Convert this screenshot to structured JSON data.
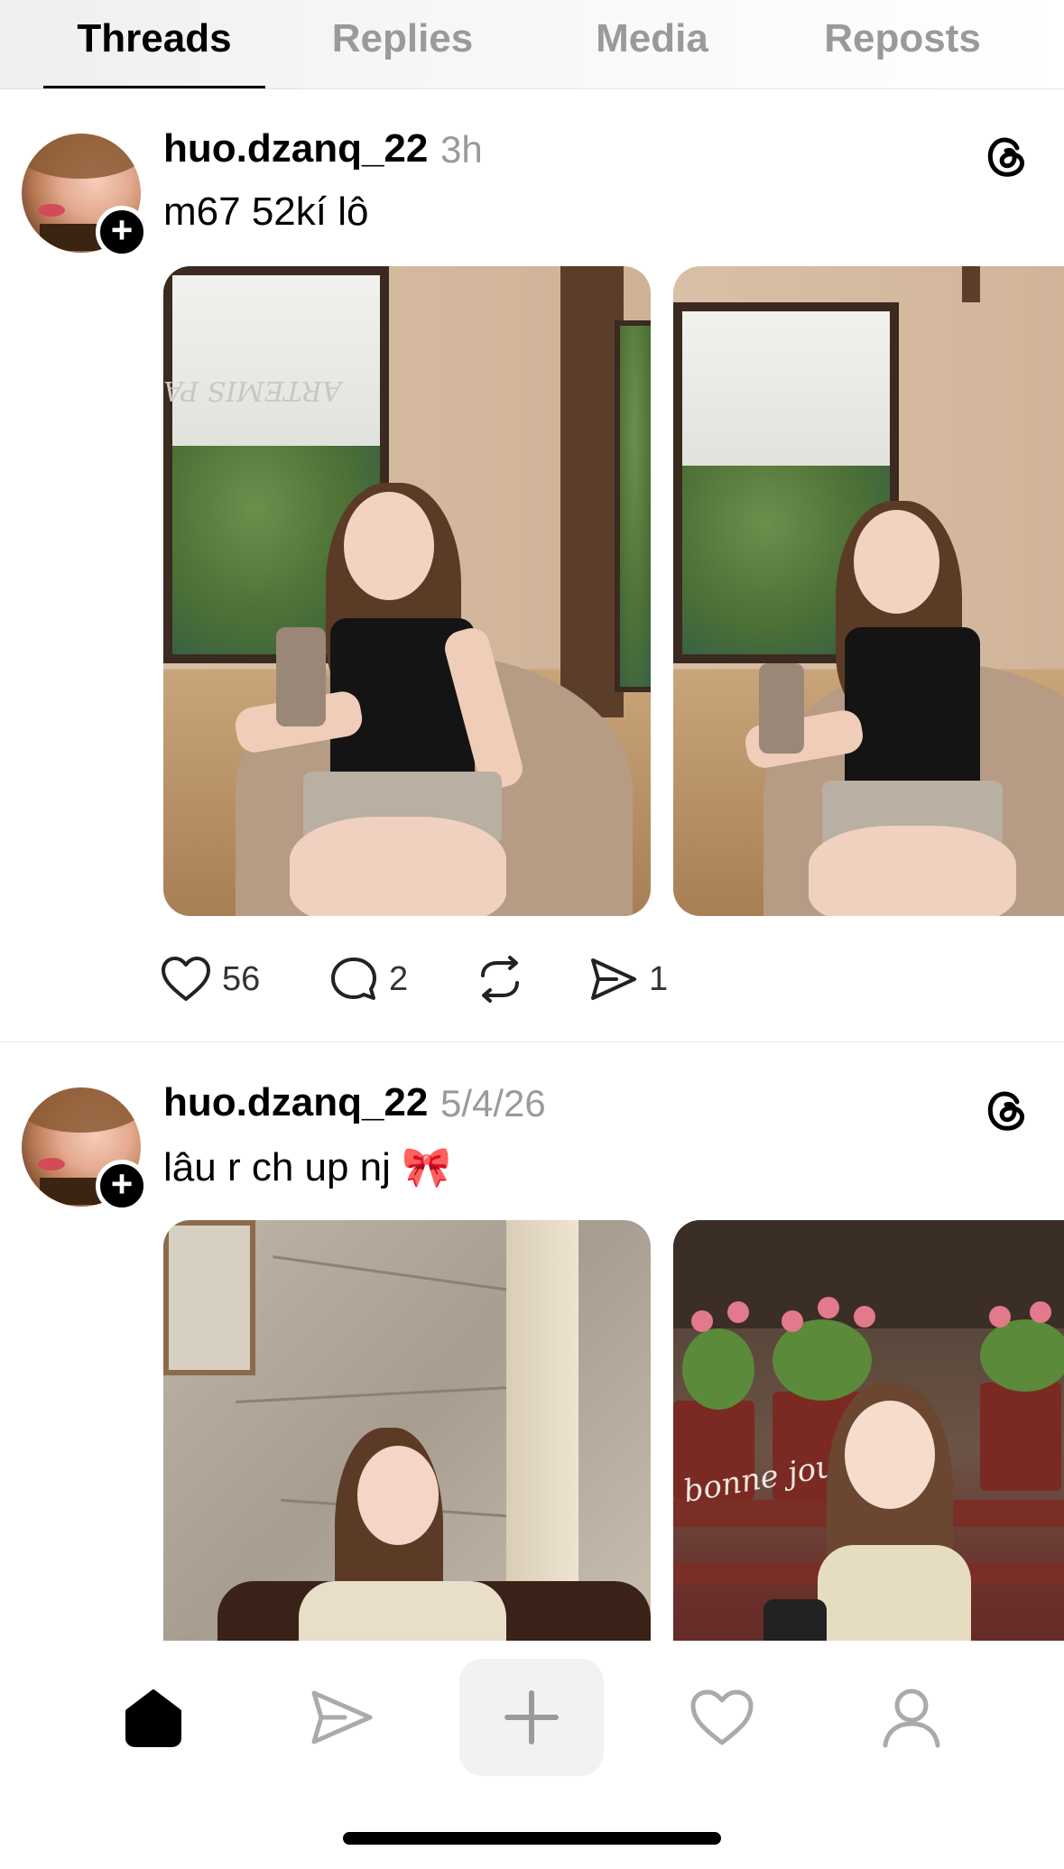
{
  "tabs": [
    {
      "label": "Threads",
      "active": true
    },
    {
      "label": "Replies",
      "active": false
    },
    {
      "label": "Media",
      "active": false
    },
    {
      "label": "Reposts",
      "active": false
    }
  ],
  "posts": [
    {
      "username": "huo.dzanq_22",
      "time": "3h",
      "caption": "m67 52kí lô",
      "storefront_sign": "ARTEMIS PA",
      "likes": "56",
      "replies": "2",
      "shares": "1"
    },
    {
      "username": "huo.dzanq_22",
      "time": "5/4/26",
      "caption": "lâu r ch up nj 🎀",
      "window_script": "bonne journée"
    }
  ],
  "icons": {
    "like": "heart-icon",
    "reply": "comment-icon",
    "repost": "repost-icon",
    "share": "send-icon",
    "threads": "threads-logo-icon",
    "follow": "plus-icon"
  },
  "bottom_nav": [
    "home-icon",
    "send-icon",
    "plus-icon",
    "heart-icon",
    "profile-icon"
  ],
  "colors": {
    "muted_text": "#9a9a9a",
    "active_text": "#000000",
    "divider": "#e6e6e6"
  }
}
